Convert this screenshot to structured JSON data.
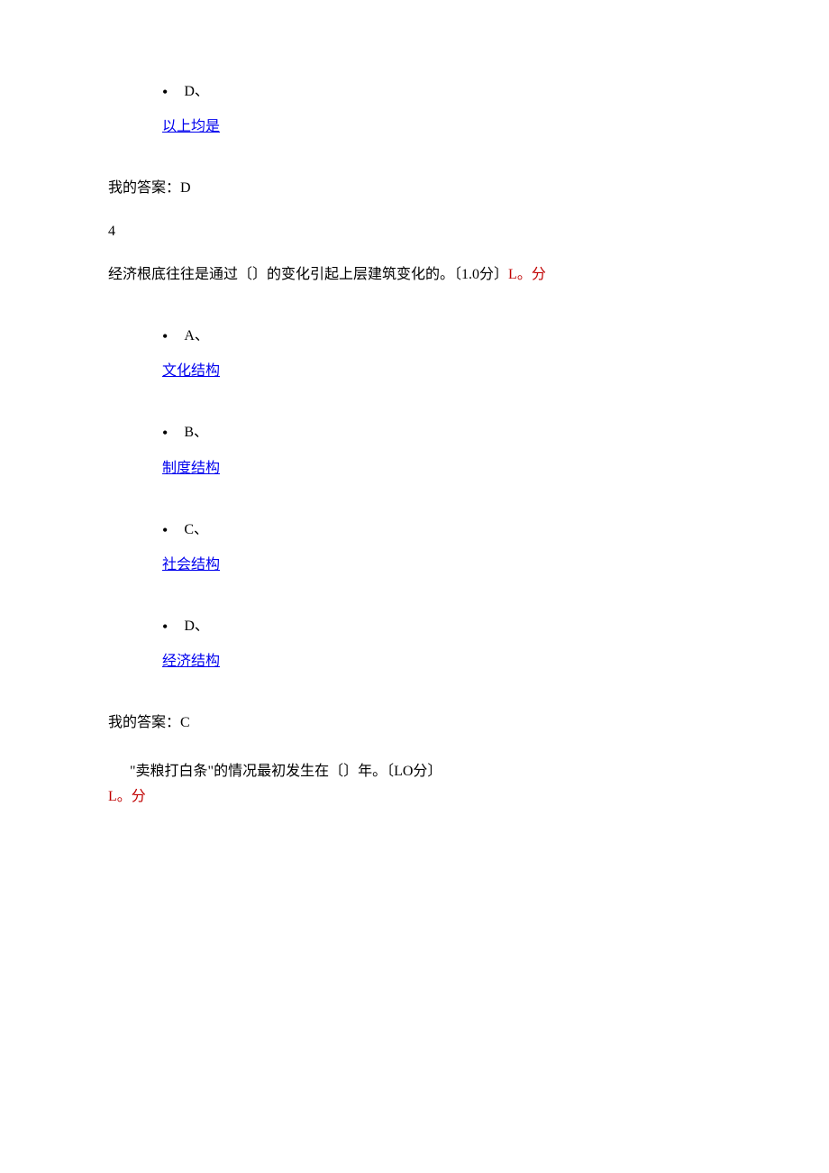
{
  "q3": {
    "optionD": {
      "letter": "D、",
      "text": "以上均是"
    },
    "myAnswerLabel": "我的答案：",
    "myAnswerLetter": "D"
  },
  "q4": {
    "number": "4",
    "stem_a": "经济根底往往是通过〔〕的变化引起上层建筑变化的。〔",
    "stem_b": "1.0",
    "stem_c": "分〕",
    "stem_d": "L",
    "stem_e": "。分",
    "options": {
      "A": {
        "letter": "A、",
        "text": "文化结构"
      },
      "B": {
        "letter": "B、",
        "text": "制度结构"
      },
      "C": {
        "letter": "C、",
        "text": "社会结构"
      },
      "D": {
        "letter": "D、",
        "text": "经济结构"
      }
    },
    "myAnswerLabel": "我的答案：",
    "myAnswerLetter": "C"
  },
  "q5": {
    "stem_a": "\"卖粮打白条\"的情况最初发生在〔〕年。〔",
    "stem_b": "LO",
    "stem_c": "分〕",
    "score_a": "L",
    "score_b": "。分"
  }
}
